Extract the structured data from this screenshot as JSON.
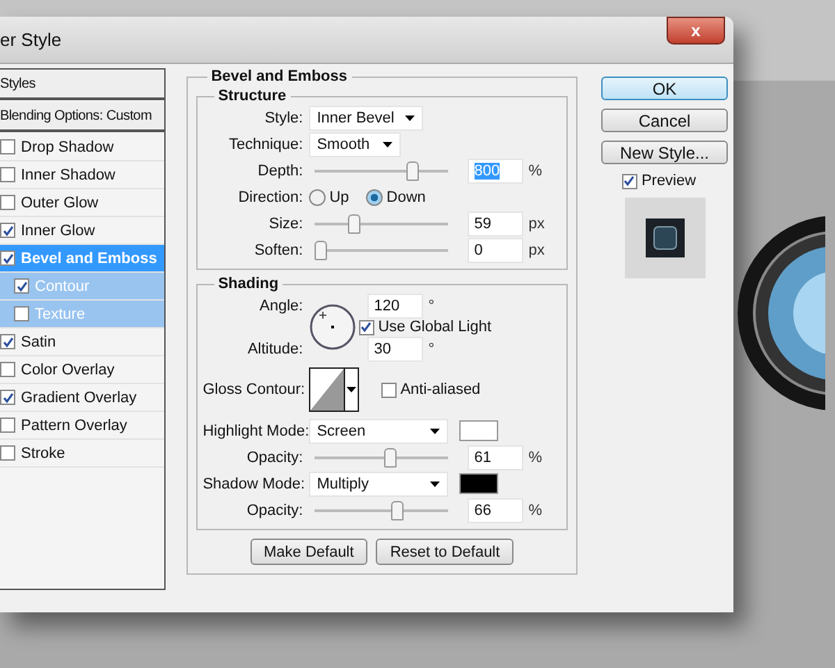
{
  "window": {
    "title": "er Style",
    "close": "x"
  },
  "styles_panel": {
    "header": "Styles",
    "blending": "Blending Options: Custom",
    "items": [
      {
        "label": "Drop Shadow",
        "checked": false,
        "selected": false
      },
      {
        "label": "Inner Shadow",
        "checked": false,
        "selected": false
      },
      {
        "label": "Outer Glow",
        "checked": false,
        "selected": false
      },
      {
        "label": "Inner Glow",
        "checked": true,
        "selected": false
      },
      {
        "label": "Bevel and Emboss",
        "checked": true,
        "selected": true,
        "children": [
          {
            "label": "Contour",
            "checked": true,
            "selected": false
          },
          {
            "label": "Texture",
            "checked": false,
            "selected": false
          }
        ]
      },
      {
        "label": "Satin",
        "checked": true,
        "selected": false
      },
      {
        "label": "Color Overlay",
        "checked": false,
        "selected": false
      },
      {
        "label": "Gradient Overlay",
        "checked": true,
        "selected": false
      },
      {
        "label": "Pattern Overlay",
        "checked": false,
        "selected": false
      },
      {
        "label": "Stroke",
        "checked": false,
        "selected": false
      }
    ]
  },
  "bevel_and_emboss": {
    "title": "Bevel and Emboss",
    "structure": {
      "title": "Structure",
      "style": {
        "label": "Style:",
        "value": "Inner Bevel"
      },
      "technique": {
        "label": "Technique:",
        "value": "Smooth"
      },
      "depth": {
        "label": "Depth:",
        "level": 0.76,
        "value": "800",
        "unit": "%",
        "highlighted": true
      },
      "direction": {
        "label": "Direction:",
        "options": [
          {
            "label": "Up",
            "selected": false
          },
          {
            "label": "Down",
            "selected": true
          }
        ]
      },
      "size": {
        "label": "Size:",
        "level": 0.28,
        "value": "59",
        "unit": "px",
        "highlighted": false
      },
      "soften": {
        "label": "Soften:",
        "level": 0,
        "value": "0",
        "unit": "px",
        "highlighted": false
      }
    },
    "shading": {
      "title": "Shading",
      "angle": {
        "label": "Angle:",
        "value": "120",
        "unit": "°"
      },
      "use_global_light": {
        "label": "Use Global Light",
        "checked": true
      },
      "altitude": {
        "label": "Altitude:",
        "value": "30",
        "unit": "°"
      },
      "gloss_contour": {
        "label": "Gloss Contour:"
      },
      "anti_aliased": {
        "label": "Anti-aliased",
        "checked": false
      },
      "highlight_mode": {
        "label": "Highlight Mode:",
        "value": "Screen",
        "color": "#ffffff"
      },
      "highlight_opacity": {
        "label": "Opacity:",
        "level": 0.58,
        "value": "61",
        "unit": "%",
        "highlighted": false
      },
      "shadow_mode": {
        "label": "Shadow Mode:",
        "value": "Multiply",
        "color": "#000000"
      },
      "shadow_opacity": {
        "label": "Opacity:",
        "level": 0.63,
        "value": "66",
        "unit": "%",
        "highlighted": false
      }
    },
    "buttons": [
      "Make Default",
      "Reset to Default"
    ]
  },
  "side_buttons": [
    {
      "label": "OK",
      "default": true
    },
    {
      "label": "Cancel",
      "default": false
    },
    {
      "label": "New Style...",
      "default": false
    }
  ],
  "preview": {
    "label": "Preview",
    "checked": true
  }
}
